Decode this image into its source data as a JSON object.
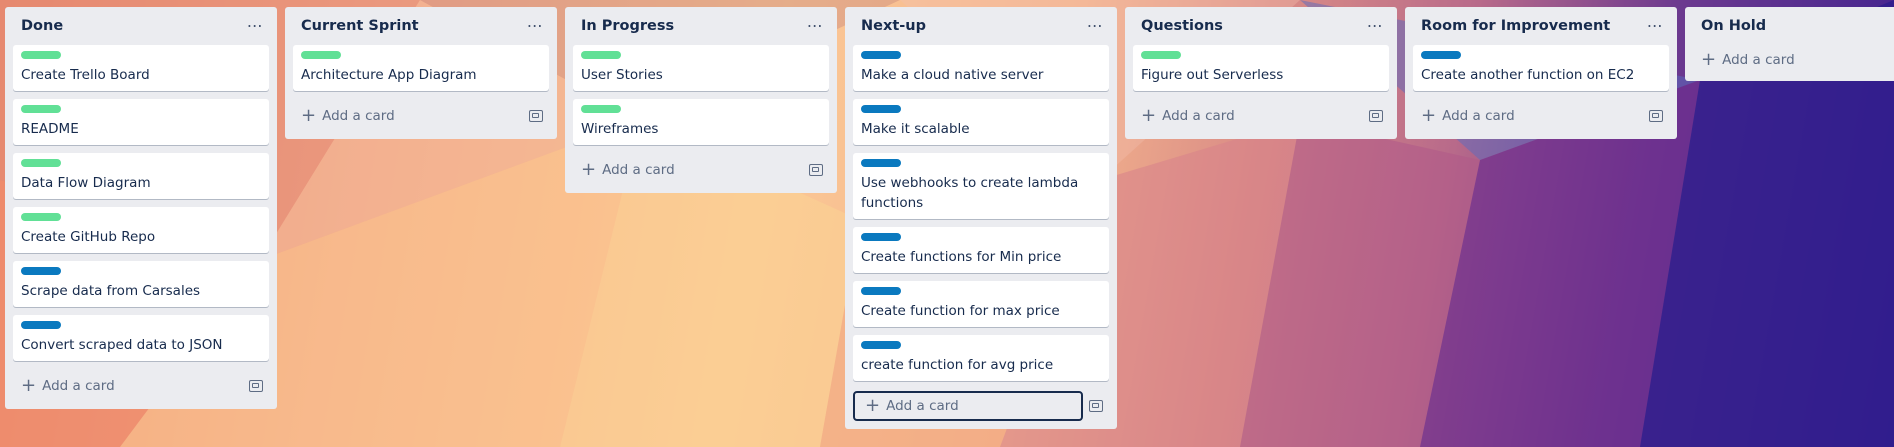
{
  "colors": {
    "green": "#61e096",
    "blue": "#0a79bf"
  },
  "lists": [
    {
      "title": "Done",
      "cards": [
        {
          "label": "green",
          "title": "Create Trello Board"
        },
        {
          "label": "green",
          "title": "README"
        },
        {
          "label": "green",
          "title": "Data Flow Diagram"
        },
        {
          "label": "green",
          "title": "Create GitHub Repo"
        },
        {
          "label": "blue",
          "title": "Scrape data from Carsales"
        },
        {
          "label": "blue",
          "title": "Convert scraped data to JSON"
        }
      ],
      "add_label": "Add a card",
      "template": true
    },
    {
      "title": "Current Sprint",
      "cards": [
        {
          "label": "green",
          "title": "Architecture App Diagram"
        }
      ],
      "add_label": "Add a card",
      "template": true
    },
    {
      "title": "In Progress",
      "cards": [
        {
          "label": "green",
          "title": "User Stories"
        },
        {
          "label": "green",
          "title": "Wireframes"
        }
      ],
      "add_label": "Add a card",
      "template": true
    },
    {
      "title": "Next-up",
      "cards": [
        {
          "label": "blue",
          "title": "Make a cloud native server"
        },
        {
          "label": "blue",
          "title": "Make it scalable"
        },
        {
          "label": "blue",
          "title": "Use webhooks to create lambda functions"
        },
        {
          "label": "blue",
          "title": "Create functions for Min price"
        },
        {
          "label": "blue",
          "title": "Create function for max price"
        },
        {
          "label": "blue",
          "title": "create function for avg price"
        }
      ],
      "add_label": "Add a card",
      "template": true,
      "focused": true
    },
    {
      "title": "Questions",
      "cards": [
        {
          "label": "green",
          "title": "Figure out Serverless"
        }
      ],
      "add_label": "Add a card",
      "template": true
    },
    {
      "title": "Room for Improvement",
      "cards": [
        {
          "label": "blue",
          "title": "Create another function on EC2"
        }
      ],
      "add_label": "Add a card",
      "template": true
    },
    {
      "title": "On Hold",
      "cards": [],
      "add_label": "Add a card",
      "template": false,
      "no_menu": true
    }
  ]
}
